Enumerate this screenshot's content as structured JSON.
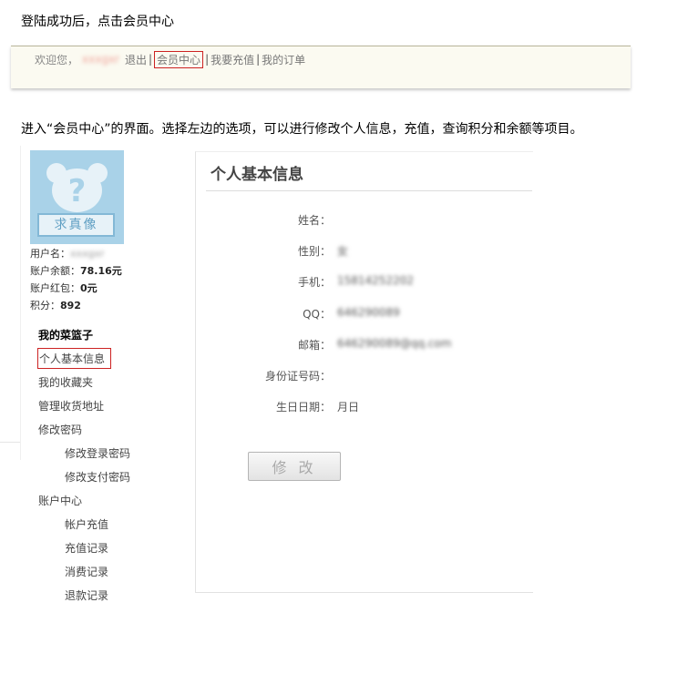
{
  "captions": {
    "step1": "登陆成功后，点击会员中心",
    "step2": "进入“会员中心”的界面。选择左边的选项，可以进行修改个人信息，充值，查询积分和余额等项目。"
  },
  "topbar": {
    "welcome": "欢迎您，",
    "username_blurred": "xxxgxr",
    "logout": "退出",
    "member_center": "会员中心",
    "recharge": "我要充值",
    "my_orders": "我的订单",
    "separator": "|"
  },
  "avatar": {
    "sign_text": "求真像",
    "question_mark": "?"
  },
  "account": {
    "username_label": "用户名：",
    "username_value": "xxxgxr",
    "balance_label": "账户余额：",
    "balance_value": "78.16元",
    "redpacket_label": "账户红包：",
    "redpacket_value": "0元",
    "points_label": "积分：",
    "points_value": "892"
  },
  "menu": {
    "basket": "我的菜篮子",
    "personal_info": "个人基本信息",
    "favorites": "我的收藏夹",
    "addresses": "管理收货地址",
    "change_password": "修改密码",
    "login_password": "修改登录密码",
    "pay_password": "修改支付密码",
    "account_center": "账户中心",
    "account_recharge": "帐户充值",
    "recharge_records": "充值记录",
    "consumption_records": "消费记录",
    "refund_records": "退款记录"
  },
  "panel": {
    "title": "个人基本信息",
    "fields": [
      {
        "label": "姓名：",
        "value": ""
      },
      {
        "label": "性别：",
        "value": "女"
      },
      {
        "label": "手机：",
        "value": "15814252202"
      },
      {
        "label": "QQ：",
        "value": "646290089"
      },
      {
        "label": "邮箱：",
        "value": "646290089@qq.com"
      },
      {
        "label": "身份证号码：",
        "value": ""
      },
      {
        "label": "生日日期：",
        "value": "月日"
      }
    ],
    "modify_button": "修 改"
  }
}
